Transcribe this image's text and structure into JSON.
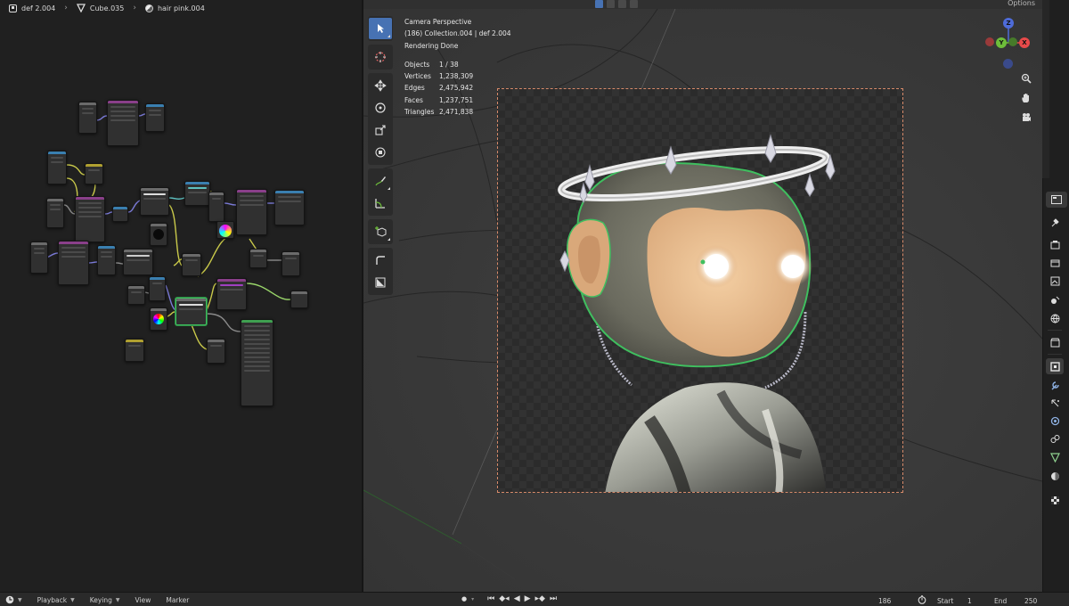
{
  "node_editor": {
    "breadcrumbs": [
      {
        "icon": "object-icon",
        "label": "def 2.004"
      },
      {
        "icon": "mesh-data-icon",
        "label": "Cube.035"
      },
      {
        "icon": "material-icon",
        "label": "hair pink.004"
      }
    ]
  },
  "viewport": {
    "header": {
      "options_label": "Options"
    },
    "overlay": {
      "view_name": "Camera Perspective",
      "collection": "(186) Collection.004 | def 2.004",
      "status": "Rendering Done",
      "stats": [
        {
          "label": "Objects",
          "value": "1 / 38"
        },
        {
          "label": "Vertices",
          "value": "1,238,309"
        },
        {
          "label": "Edges",
          "value": "2,475,942"
        },
        {
          "label": "Faces",
          "value": "1,237,751"
        },
        {
          "label": "Triangles",
          "value": "2,471,838"
        }
      ]
    },
    "toolbar": [
      "select-box-icon",
      "cursor-icon",
      "move-icon",
      "rotate-icon",
      "scale-icon",
      "transform-icon",
      "annotate-icon",
      "measure-icon",
      "add-cube-icon",
      "extrude-icon",
      "shrink-icon"
    ],
    "gizmo": {
      "x_label": "X",
      "y_label": "Y",
      "z_label": "Z"
    },
    "colors": {
      "x": "#e84a4a",
      "y": "#6dbd3a",
      "z": "#4e6bd8",
      "selection": "#3fbf5f",
      "camera_frame": "#d78a6a",
      "active_tool": "#4772b3"
    }
  },
  "properties_tabs": [
    "tool-icon",
    "render-icon",
    "output-icon",
    "view-layer-icon",
    "scene-icon",
    "world-icon",
    "collection-icon",
    "object-icon",
    "modifier-icon",
    "particles-icon",
    "physics-icon",
    "constraints-icon",
    "data-icon",
    "material-icon",
    "texture-icon"
  ],
  "timeline": {
    "menus": [
      "Playback",
      "Keying",
      "View",
      "Marker"
    ],
    "current_frame": "186",
    "start_label": "Start",
    "start_value": "1",
    "end_label": "End",
    "end_value": "250"
  }
}
